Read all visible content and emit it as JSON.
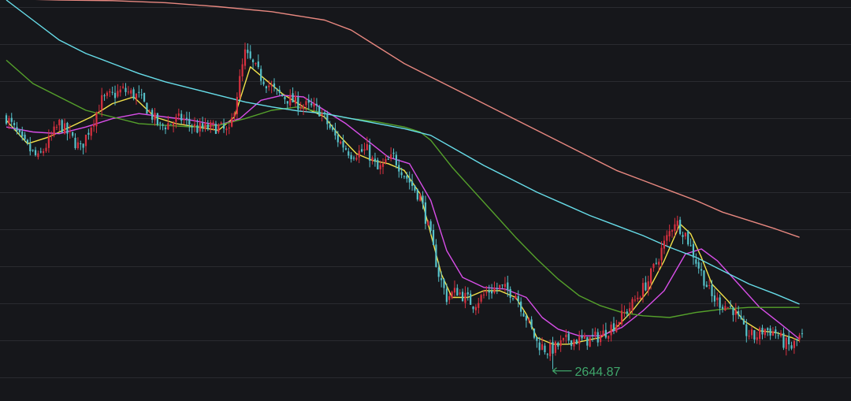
{
  "chart_data": {
    "type": "candlestick",
    "title": "",
    "xlabel": "",
    "ylabel": "",
    "ylim": [
      2550,
      3750
    ],
    "x_range": [
      0,
      300
    ],
    "grid": "horizontal",
    "colors": {
      "background": "#16171b",
      "grid": "#2a2b30",
      "up": "#d8303f",
      "down": "#56c1c9",
      "ma_fast": "#f2e24a",
      "ma_mid": "#d84ee8",
      "ma_slow": "#55a12b",
      "ma_long": "#67dde9",
      "ma_longest": "#e88880",
      "low_marker": "#3fa66b"
    },
    "annotations": [
      {
        "text": "2644.87",
        "x": 206,
        "y": 2644.87,
        "arrow": "left"
      }
    ],
    "price_anchors": [
      [
        0,
        3400
      ],
      [
        6,
        3325
      ],
      [
        12,
        3275
      ],
      [
        20,
        3380
      ],
      [
        28,
        3305
      ],
      [
        36,
        3450
      ],
      [
        44,
        3480
      ],
      [
        50,
        3460
      ],
      [
        58,
        3370
      ],
      [
        66,
        3395
      ],
      [
        72,
        3365
      ],
      [
        80,
        3370
      ],
      [
        84,
        3350
      ],
      [
        90,
        3590
      ],
      [
        96,
        3520
      ],
      [
        102,
        3470
      ],
      [
        110,
        3440
      ],
      [
        118,
        3420
      ],
      [
        124,
        3340
      ],
      [
        130,
        3290
      ],
      [
        136,
        3300
      ],
      [
        140,
        3240
      ],
      [
        146,
        3280
      ],
      [
        150,
        3230
      ],
      [
        156,
        3160
      ],
      [
        160,
        3040
      ],
      [
        163,
        2930
      ],
      [
        166,
        2860
      ],
      [
        170,
        2880
      ],
      [
        176,
        2840
      ],
      [
        182,
        2880
      ],
      [
        186,
        2890
      ],
      [
        192,
        2870
      ],
      [
        196,
        2800
      ],
      [
        200,
        2725
      ],
      [
        204,
        2700
      ],
      [
        207,
        2710
      ],
      [
        212,
        2735
      ],
      [
        218,
        2730
      ],
      [
        224,
        2745
      ],
      [
        230,
        2785
      ],
      [
        236,
        2840
      ],
      [
        242,
        2910
      ],
      [
        248,
        3020
      ],
      [
        252,
        3090
      ],
      [
        256,
        3050
      ],
      [
        260,
        2970
      ],
      [
        266,
        2860
      ],
      [
        270,
        2840
      ],
      [
        274,
        2825
      ],
      [
        278,
        2760
      ],
      [
        282,
        2740
      ],
      [
        286,
        2765
      ],
      [
        290,
        2755
      ],
      [
        293,
        2725
      ],
      [
        296,
        2710
      ],
      [
        299,
        2740
      ]
    ],
    "series": [
      {
        "name": "",
        "type": "ma",
        "color": "#f2e24a",
        "points": [
          [
            0,
            3390
          ],
          [
            8,
            3320
          ],
          [
            16,
            3340
          ],
          [
            24,
            3370
          ],
          [
            32,
            3400
          ],
          [
            40,
            3440
          ],
          [
            48,
            3460
          ],
          [
            56,
            3400
          ],
          [
            64,
            3380
          ],
          [
            72,
            3370
          ],
          [
            80,
            3360
          ],
          [
            86,
            3400
          ],
          [
            92,
            3550
          ],
          [
            98,
            3510
          ],
          [
            104,
            3470
          ],
          [
            112,
            3430
          ],
          [
            120,
            3400
          ],
          [
            126,
            3340
          ],
          [
            132,
            3290
          ],
          [
            138,
            3270
          ],
          [
            144,
            3260
          ],
          [
            150,
            3240
          ],
          [
            156,
            3170
          ],
          [
            160,
            3050
          ],
          [
            164,
            2930
          ],
          [
            168,
            2860
          ],
          [
            174,
            2860
          ],
          [
            180,
            2880
          ],
          [
            186,
            2880
          ],
          [
            192,
            2860
          ],
          [
            196,
            2810
          ],
          [
            200,
            2740
          ],
          [
            206,
            2720
          ],
          [
            212,
            2720
          ],
          [
            218,
            2730
          ],
          [
            224,
            2740
          ],
          [
            230,
            2770
          ],
          [
            236,
            2820
          ],
          [
            242,
            2880
          ],
          [
            248,
            2970
          ],
          [
            254,
            3080
          ],
          [
            258,
            3050
          ],
          [
            262,
            2980
          ],
          [
            266,
            2900
          ],
          [
            272,
            2850
          ],
          [
            278,
            2790
          ],
          [
            284,
            2760
          ],
          [
            290,
            2755
          ],
          [
            296,
            2740
          ],
          [
            299,
            2730
          ]
        ]
      },
      {
        "name": "",
        "type": "ma",
        "color": "#d84ee8",
        "points": [
          [
            0,
            3370
          ],
          [
            10,
            3355
          ],
          [
            20,
            3350
          ],
          [
            30,
            3370
          ],
          [
            40,
            3395
          ],
          [
            50,
            3410
          ],
          [
            60,
            3400
          ],
          [
            70,
            3390
          ],
          [
            80,
            3375
          ],
          [
            88,
            3395
          ],
          [
            96,
            3450
          ],
          [
            104,
            3465
          ],
          [
            112,
            3460
          ],
          [
            120,
            3420
          ],
          [
            128,
            3380
          ],
          [
            136,
            3330
          ],
          [
            144,
            3280
          ],
          [
            152,
            3260
          ],
          [
            160,
            3150
          ],
          [
            166,
            3000
          ],
          [
            172,
            2920
          ],
          [
            180,
            2890
          ],
          [
            188,
            2885
          ],
          [
            196,
            2860
          ],
          [
            202,
            2800
          ],
          [
            208,
            2765
          ],
          [
            216,
            2745
          ],
          [
            224,
            2745
          ],
          [
            232,
            2770
          ],
          [
            240,
            2820
          ],
          [
            248,
            2880
          ],
          [
            256,
            2990
          ],
          [
            262,
            3005
          ],
          [
            268,
            2970
          ],
          [
            276,
            2900
          ],
          [
            284,
            2830
          ],
          [
            292,
            2780
          ],
          [
            299,
            2735
          ]
        ]
      },
      {
        "name": "",
        "type": "ma",
        "color": "#55a12b",
        "points": [
          [
            0,
            3570
          ],
          [
            10,
            3500
          ],
          [
            20,
            3460
          ],
          [
            30,
            3420
          ],
          [
            40,
            3400
          ],
          [
            50,
            3380
          ],
          [
            60,
            3375
          ],
          [
            70,
            3370
          ],
          [
            80,
            3375
          ],
          [
            90,
            3395
          ],
          [
            100,
            3420
          ],
          [
            110,
            3430
          ],
          [
            120,
            3410
          ],
          [
            130,
            3395
          ],
          [
            140,
            3385
          ],
          [
            150,
            3370
          ],
          [
            156,
            3355
          ],
          [
            160,
            3330
          ],
          [
            168,
            3250
          ],
          [
            176,
            3180
          ],
          [
            184,
            3110
          ],
          [
            192,
            3040
          ],
          [
            200,
            2975
          ],
          [
            208,
            2915
          ],
          [
            216,
            2865
          ],
          [
            224,
            2835
          ],
          [
            232,
            2815
          ],
          [
            240,
            2805
          ],
          [
            250,
            2800
          ],
          [
            260,
            2815
          ],
          [
            270,
            2825
          ],
          [
            280,
            2830
          ],
          [
            290,
            2830
          ],
          [
            299,
            2830
          ]
        ]
      },
      {
        "name": "",
        "type": "ma",
        "color": "#67dde9",
        "points": [
          [
            0,
            3750
          ],
          [
            10,
            3690
          ],
          [
            20,
            3630
          ],
          [
            30,
            3590
          ],
          [
            40,
            3560
          ],
          [
            50,
            3530
          ],
          [
            60,
            3505
          ],
          [
            70,
            3485
          ],
          [
            80,
            3465
          ],
          [
            90,
            3445
          ],
          [
            100,
            3430
          ],
          [
            110,
            3418
          ],
          [
            120,
            3410
          ],
          [
            130,
            3395
          ],
          [
            140,
            3380
          ],
          [
            150,
            3365
          ],
          [
            160,
            3345
          ],
          [
            170,
            3300
          ],
          [
            180,
            3255
          ],
          [
            190,
            3215
          ],
          [
            200,
            3175
          ],
          [
            210,
            3140
          ],
          [
            220,
            3105
          ],
          [
            230,
            3075
          ],
          [
            240,
            3045
          ],
          [
            250,
            3010
          ],
          [
            260,
            2980
          ],
          [
            270,
            2940
          ],
          [
            280,
            2900
          ],
          [
            290,
            2870
          ],
          [
            299,
            2840
          ]
        ]
      },
      {
        "name": "",
        "type": "ma",
        "color": "#e88880",
        "points": [
          [
            3,
            3753
          ],
          [
            20,
            3750
          ],
          [
            40,
            3748
          ],
          [
            60,
            3742
          ],
          [
            80,
            3730
          ],
          [
            100,
            3715
          ],
          [
            120,
            3690
          ],
          [
            130,
            3660
          ],
          [
            140,
            3610
          ],
          [
            150,
            3560
          ],
          [
            160,
            3520
          ],
          [
            170,
            3480
          ],
          [
            180,
            3440
          ],
          [
            190,
            3400
          ],
          [
            200,
            3360
          ],
          [
            210,
            3320
          ],
          [
            220,
            3280
          ],
          [
            230,
            3240
          ],
          [
            240,
            3210
          ],
          [
            250,
            3180
          ],
          [
            260,
            3150
          ],
          [
            270,
            3115
          ],
          [
            280,
            3090
          ],
          [
            290,
            3065
          ],
          [
            299,
            3040
          ]
        ]
      }
    ]
  }
}
